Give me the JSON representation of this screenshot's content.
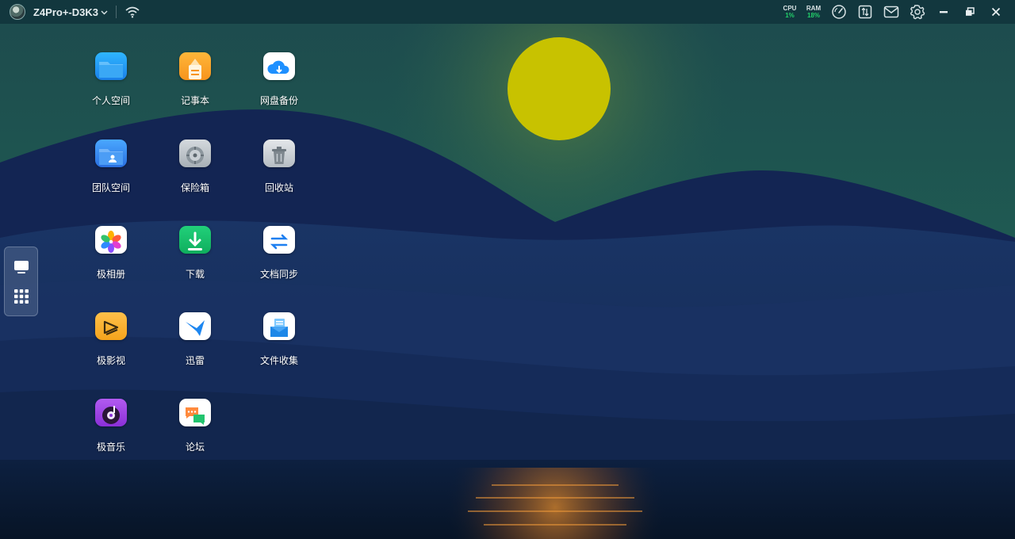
{
  "topbar": {
    "device_name": "Z4Pro+-D3K3",
    "cpu": {
      "label": "CPU",
      "value": "1%"
    },
    "ram": {
      "label": "RAM",
      "value": "18%"
    },
    "tools": [
      "speedometer-icon",
      "transfer-icon",
      "mail-icon",
      "gear-icon",
      "minimize-icon",
      "restore-icon",
      "close-icon"
    ]
  },
  "dock": {
    "items": [
      "desktop-icon",
      "app-grid-icon"
    ]
  },
  "desktop": {
    "apps": [
      {
        "id": "personal-space",
        "label": "个人空间"
      },
      {
        "id": "notepad",
        "label": "记事本"
      },
      {
        "id": "cloud-backup",
        "label": "网盘备份"
      },
      {
        "id": "team-space",
        "label": "团队空间"
      },
      {
        "id": "safe-box",
        "label": "保险箱"
      },
      {
        "id": "recycle-bin",
        "label": "回收站"
      },
      {
        "id": "photo-album",
        "label": "极相册"
      },
      {
        "id": "download",
        "label": "下载"
      },
      {
        "id": "doc-sync",
        "label": "文档同步"
      },
      {
        "id": "video",
        "label": "极影视"
      },
      {
        "id": "xunlei",
        "label": "迅雷"
      },
      {
        "id": "file-collect",
        "label": "文件收集"
      },
      {
        "id": "music",
        "label": "极音乐"
      },
      {
        "id": "forum",
        "label": "论坛"
      }
    ]
  },
  "colors": {
    "topbar": "#12373e",
    "status_green": "#22d06a",
    "moon": "#c8c200",
    "sky_top": "#1d4a4d",
    "sea": "#0b1a30"
  }
}
